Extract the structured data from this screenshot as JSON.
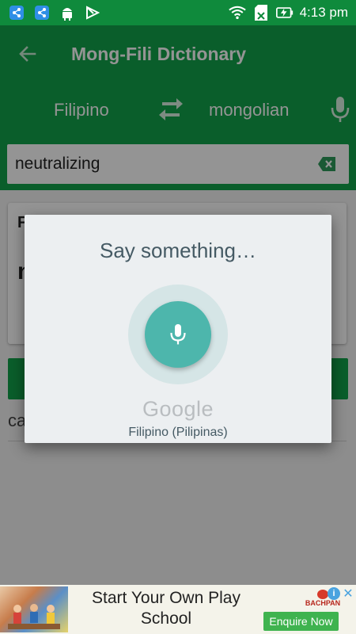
{
  "status_bar": {
    "time": "4:13 pm",
    "left_icons": [
      "share-app-icon",
      "share-app-icon",
      "android-icon",
      "google-play-icon"
    ],
    "right_icons": [
      "wifi-icon",
      "sd-card-icon",
      "battery-charging-icon"
    ]
  },
  "app_bar": {
    "title": "Mong-Fili Dictionary",
    "back_icon": "arrow-left-icon"
  },
  "language_bar": {
    "from_language": "Filipino",
    "to_language": "mongolian",
    "swap_icon": "swap-arrows-icon",
    "mic_icon": "microphone-icon"
  },
  "search": {
    "value": "neutralizing",
    "clear_icon": "backspace-clear-icon"
  },
  "result_card": {
    "header": "F",
    "word": "n"
  },
  "suggestion": {
    "text": "ca"
  },
  "voice_dialog": {
    "prompt": "Say something…",
    "mic_icon": "microphone-icon",
    "provider": "Google",
    "language": "Filipino (Pilipinas)"
  },
  "ad": {
    "headline": "Start Your Own Play School",
    "brand": "BACHPAN",
    "cta_label": "Enquire Now",
    "info_label": "i",
    "close_label": "✕"
  },
  "colors": {
    "app_green": "#12a24a",
    "status_green": "#0f8a3c",
    "dialog_background": "#eceff1",
    "mic_teal": "#4db6ac",
    "mic_halo": "#d5e5e6",
    "prompt_text": "#455a64"
  }
}
